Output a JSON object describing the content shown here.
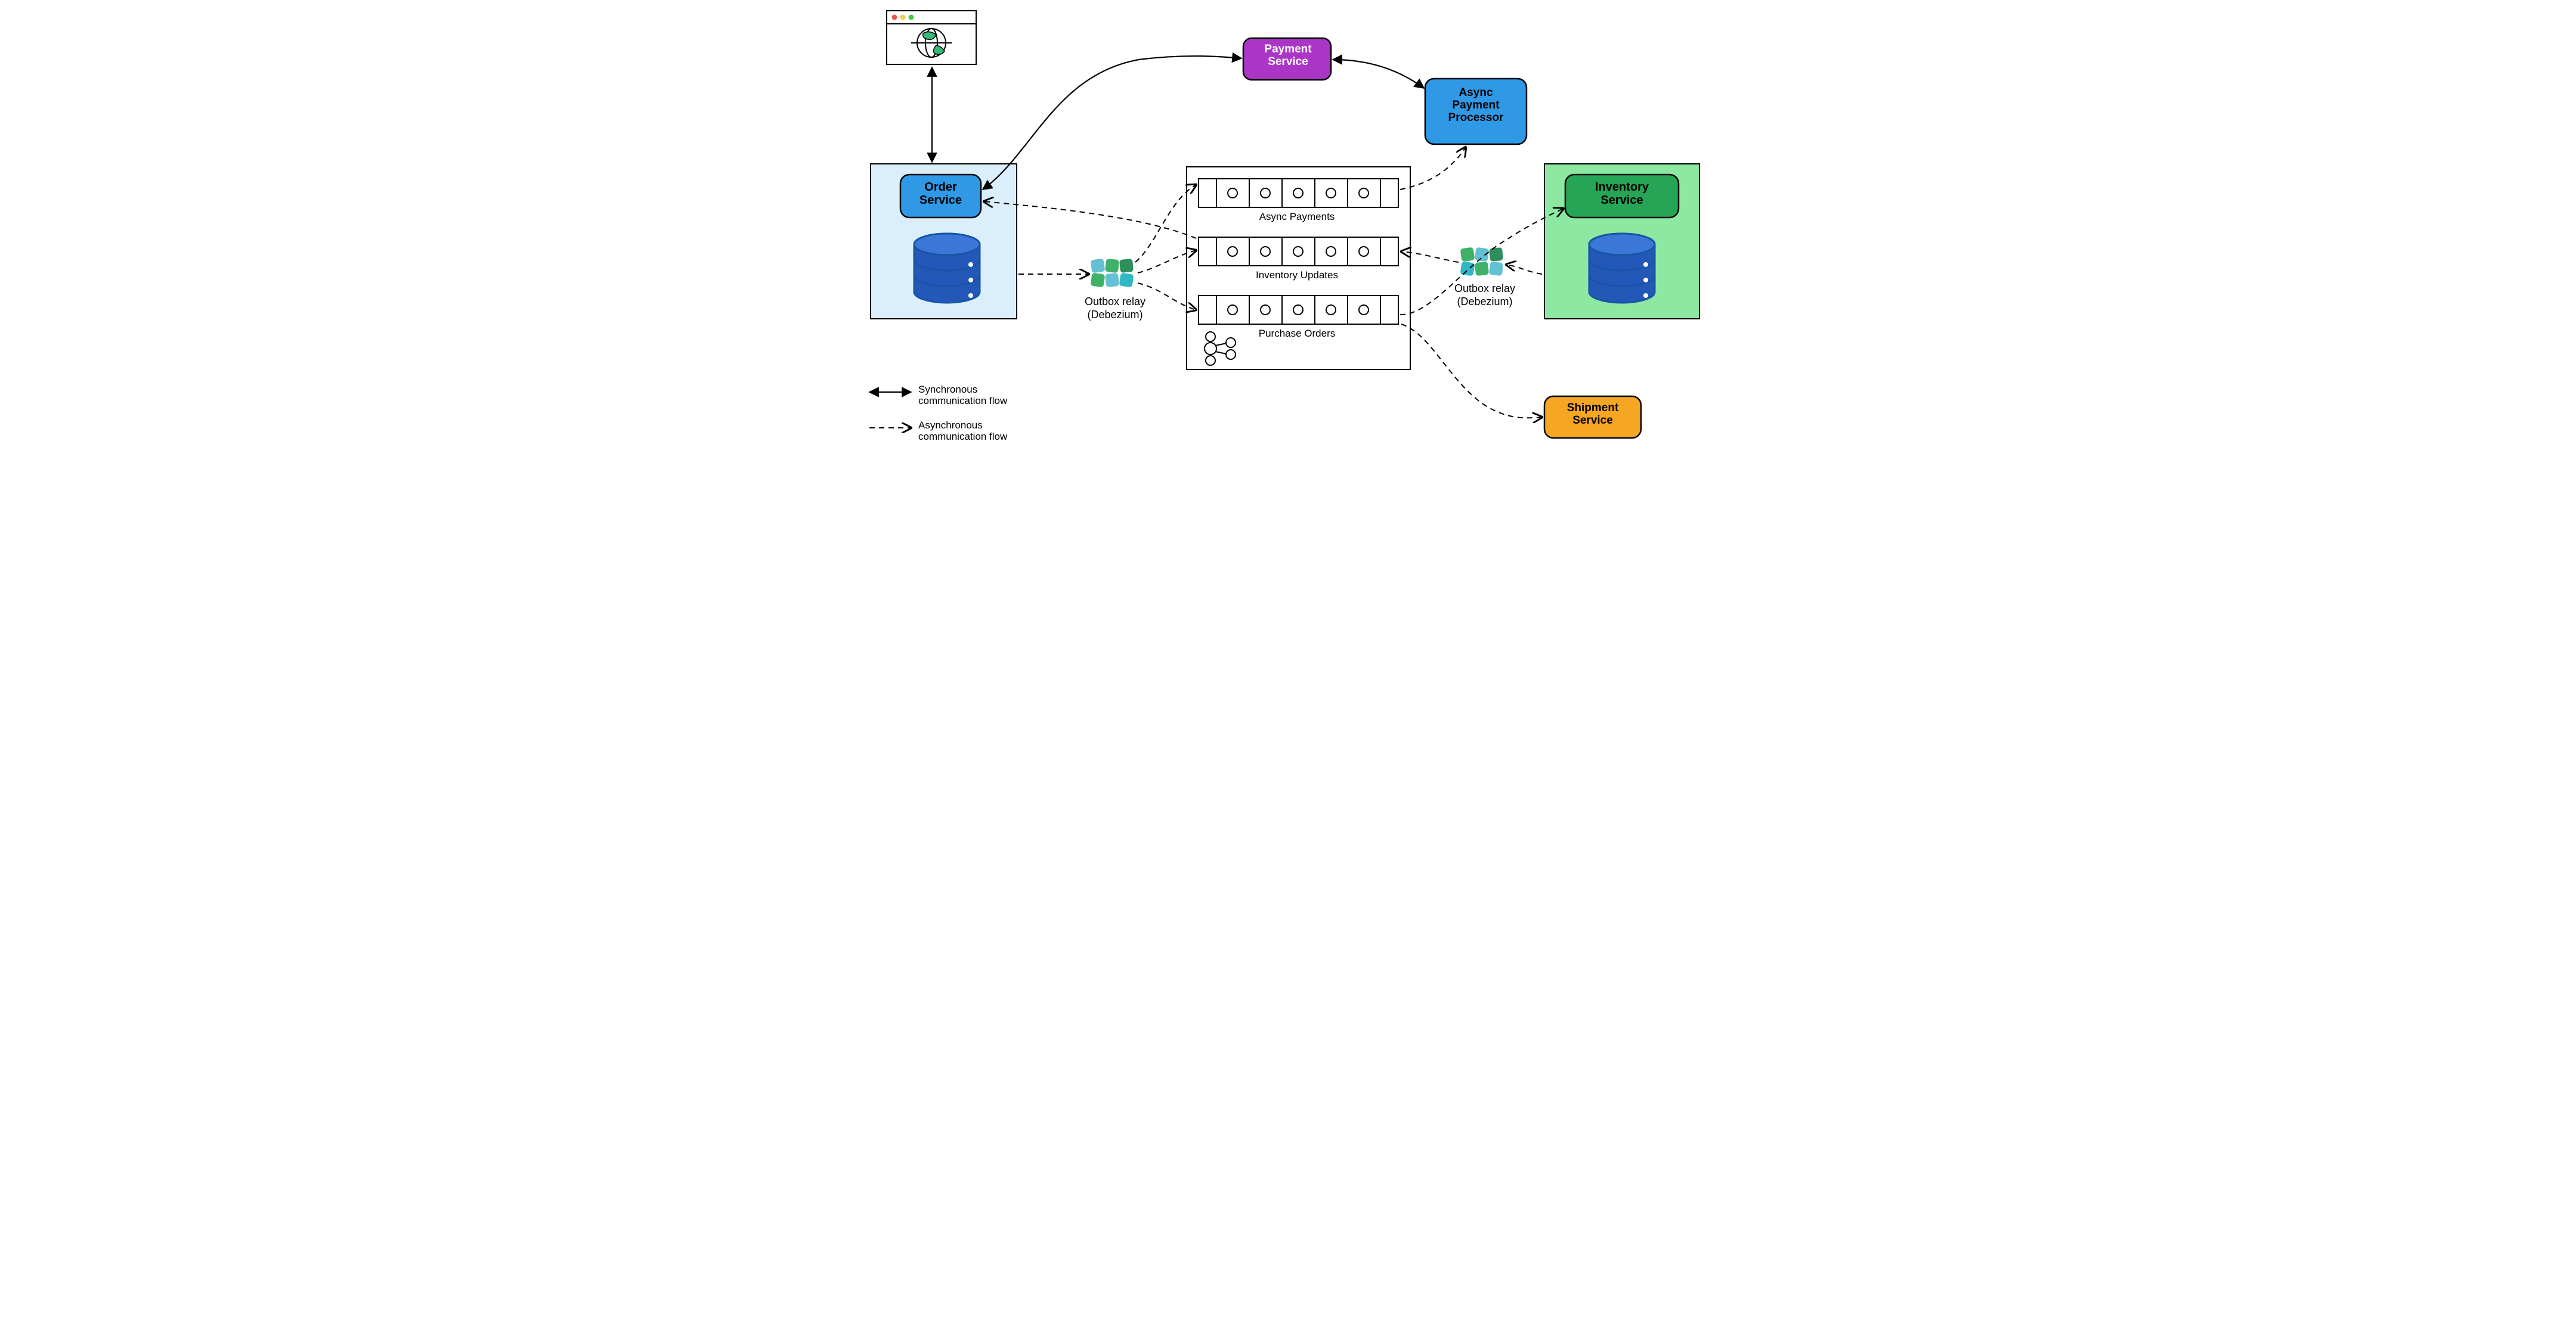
{
  "nodes": {
    "order_service": "Order\nService",
    "payment_service": "Payment\nService",
    "async_payment_processor": "Async\nPayment\nProcessor",
    "inventory_service": "Inventory\nService",
    "shipment_service": "Shipment\nService"
  },
  "message_bus": {
    "topics": [
      "Async Payments",
      "Inventory Updates",
      "Purchase Orders"
    ]
  },
  "relays": {
    "left": "Outbox relay\n(Debezium)",
    "right": "Outbox relay\n(Debezium)"
  },
  "legend": {
    "sync": "Synchronous\ncommunication flow",
    "async": "Asynchronous\ncommunication flow"
  },
  "colors": {
    "blue": "#2f99e6",
    "blue_light": "#dbeefc",
    "purple": "#ab36c6",
    "green_light": "#8de8a1",
    "green_dark": "#26a556",
    "orange": "#f5a623"
  }
}
